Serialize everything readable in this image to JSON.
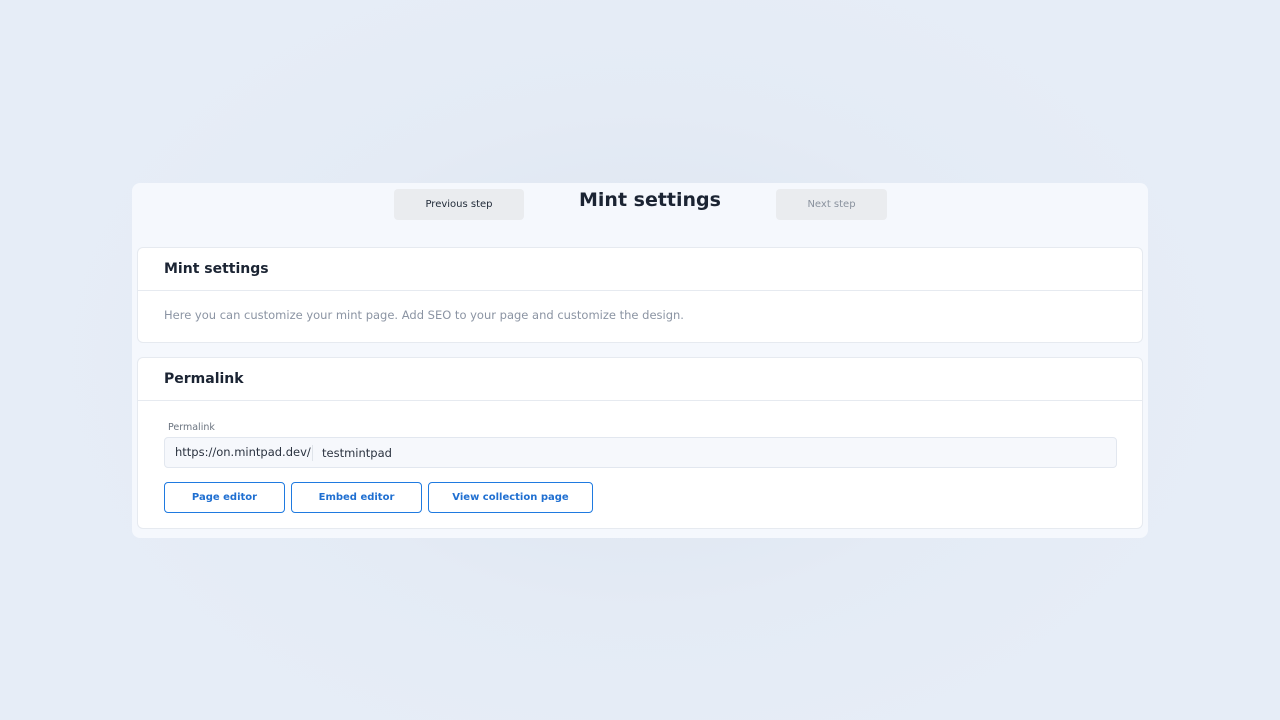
{
  "step_bar": {
    "previous_label": "Previous step",
    "title": "Mint settings",
    "next_label": "Next step"
  },
  "intro_card": {
    "heading": "Mint settings",
    "description": "Here you can customize your mint page. Add SEO to your page and customize the design."
  },
  "permalink_card": {
    "heading": "Permalink",
    "field_label": "Permalink",
    "url_prefix": "https://on.mintpad.dev/",
    "slug_value": "testmintpad",
    "buttons": {
      "page_editor": "Page editor",
      "embed_editor": "Embed editor",
      "view_collection": "View collection page"
    }
  },
  "colors": {
    "accent": "#1f7ae0",
    "background": "#e4ebf5",
    "panel": "#f5f8fd"
  }
}
